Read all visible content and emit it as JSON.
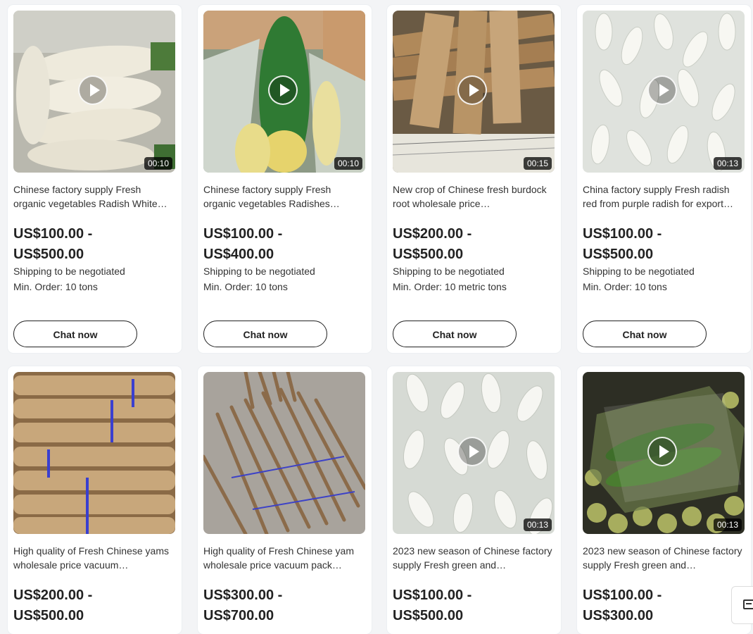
{
  "products": [
    {
      "title": "Chinese factory supply Fresh organic vegetables Radish White…",
      "price_line1": "US$100.00 -",
      "price_line2": "US$500.00",
      "shipping": "Shipping to be negotiated",
      "min_order": "Min. Order: 10 tons",
      "chat_label": "Chat now",
      "duration": "00:10",
      "has_video": true
    },
    {
      "title": "Chinese factory supply Fresh organic vegetables Radishes…",
      "price_line1": "US$100.00 -",
      "price_line2": "US$400.00",
      "shipping": "Shipping to be negotiated",
      "min_order": "Min. Order: 10 tons",
      "chat_label": "Chat now",
      "duration": "00:10",
      "has_video": true
    },
    {
      "title": "New crop of Chinese fresh burdock root wholesale price…",
      "price_line1": "US$200.00 -",
      "price_line2": "US$500.00",
      "shipping": "Shipping to be negotiated",
      "min_order": "Min. Order: 10 metric tons",
      "chat_label": "Chat now",
      "duration": "00:15",
      "has_video": true
    },
    {
      "title": "China factory supply Fresh radish red from purple radish for export…",
      "price_line1": "US$100.00 -",
      "price_line2": "US$500.00",
      "shipping": "Shipping to be negotiated",
      "min_order": "Min. Order: 10 tons",
      "chat_label": "Chat now",
      "duration": "00:13",
      "has_video": true
    },
    {
      "title": "High quality of Fresh Chinese yams wholesale price vacuum…",
      "price_line1": "US$200.00 -",
      "price_line2": "US$500.00",
      "has_video": false
    },
    {
      "title": "High quality of Fresh Chinese yam wholesale price vacuum pack…",
      "price_line1": "US$300.00 -",
      "price_line2": "US$700.00",
      "has_video": false
    },
    {
      "title": "2023 new season of Chinese factory supply Fresh green and…",
      "price_line1": "US$100.00 -",
      "price_line2": "US$500.00",
      "duration": "00:13",
      "has_video": true
    },
    {
      "title": "2023 new season of Chinese factory supply Fresh green and…",
      "price_line1": "US$100.00 -",
      "price_line2": "US$300.00",
      "duration": "00:13",
      "has_video": true
    }
  ],
  "side_button_icon": "message-icon"
}
